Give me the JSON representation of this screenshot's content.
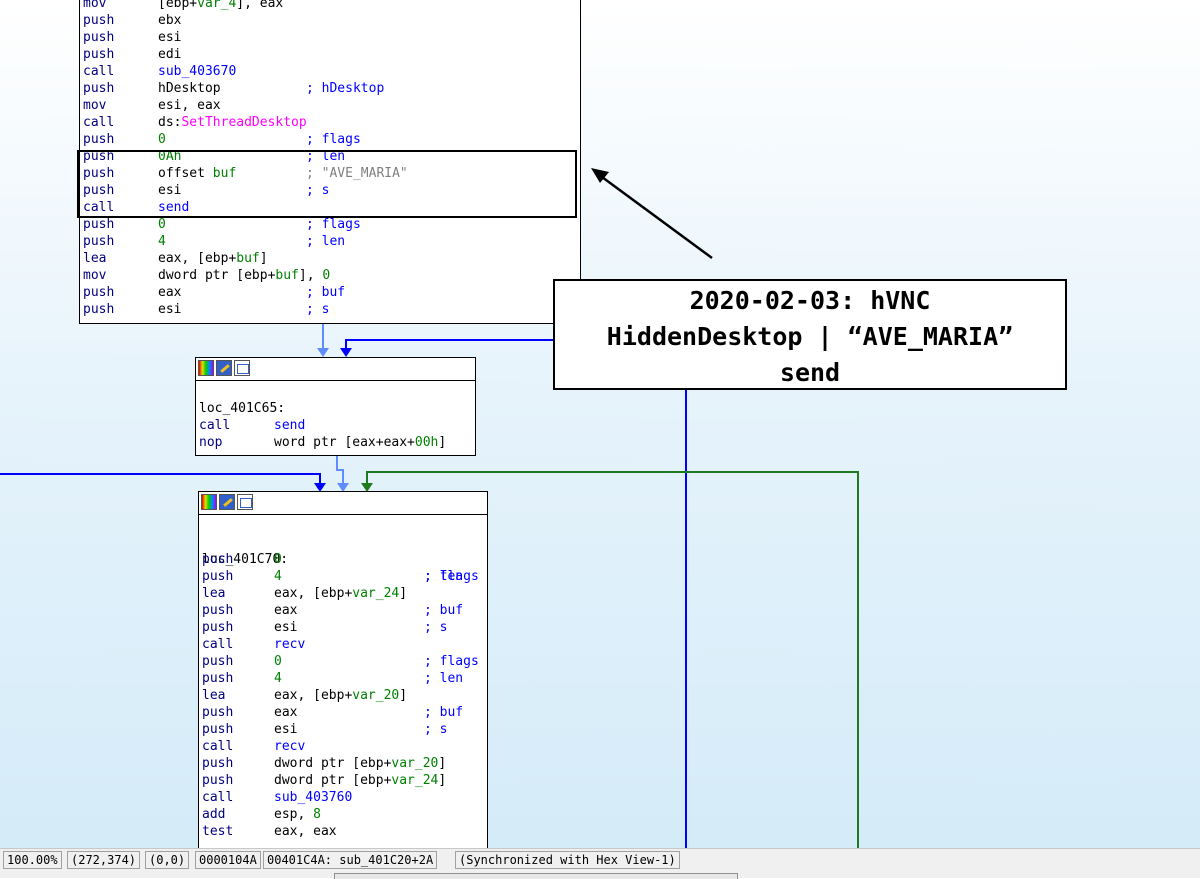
{
  "block1": {
    "lines": [
      {
        "mn": "mov",
        "op": "[ebp+var_4], eax"
      },
      {
        "mn": "push",
        "op": "ebx"
      },
      {
        "mn": "push",
        "op": "esi"
      },
      {
        "mn": "push",
        "op": "edi"
      },
      {
        "mn": "call",
        "op": "sub_403670"
      },
      {
        "mn": "push",
        "op": "hDesktop",
        "cm": "; hDesktop"
      },
      {
        "mn": "mov",
        "op": "esi, eax"
      },
      {
        "mn": "call",
        "op_prefix": "ds:",
        "op_api": "SetThreadDesktop"
      },
      {
        "mn": "push",
        "op": "0",
        "cm": "; flags"
      },
      {
        "mn": "push",
        "op": "0Ah",
        "cm": "; len"
      },
      {
        "mn": "push",
        "op": "offset buf",
        "cm": "; \"AVE_MARIA\""
      },
      {
        "mn": "push",
        "op": "esi",
        "cm": "; s"
      },
      {
        "mn": "call",
        "op": "send"
      },
      {
        "mn": "push",
        "op": "0",
        "cm": "; flags"
      },
      {
        "mn": "push",
        "op": "4",
        "cm": "; len"
      },
      {
        "mn": "lea",
        "op": "eax, [ebp+buf]"
      },
      {
        "mn": "mov",
        "op": "dword ptr [ebp+buf], 0"
      },
      {
        "mn": "push",
        "op": "eax",
        "cm": "; buf"
      },
      {
        "mn": "push",
        "op": "esi",
        "cm": "; s"
      }
    ]
  },
  "block2": {
    "label": "loc_401C65:",
    "lines": [
      {
        "mn": "call",
        "op": "send"
      },
      {
        "mn": "nop",
        "op": "word ptr [eax+eax+00h]"
      }
    ]
  },
  "block3": {
    "label": "loc_401C70:",
    "label_comment": "; flags",
    "lines": [
      {
        "mn": "push",
        "op": "0"
      },
      {
        "mn": "push",
        "op": "4",
        "cm": "; len"
      },
      {
        "mn": "lea",
        "op": "eax, [ebp+var_24]"
      },
      {
        "mn": "push",
        "op": "eax",
        "cm": "; buf"
      },
      {
        "mn": "push",
        "op": "esi",
        "cm": "; s"
      },
      {
        "mn": "call",
        "op": "recv"
      },
      {
        "mn": "push",
        "op": "0",
        "cm": "; flags"
      },
      {
        "mn": "push",
        "op": "4",
        "cm": "; len"
      },
      {
        "mn": "lea",
        "op": "eax, [ebp+var_20]"
      },
      {
        "mn": "push",
        "op": "eax",
        "cm": "; buf"
      },
      {
        "mn": "push",
        "op": "esi",
        "cm": "; s"
      },
      {
        "mn": "call",
        "op": "recv"
      },
      {
        "mn": "push",
        "op": "dword ptr [ebp+var_20]"
      },
      {
        "mn": "push",
        "op": "dword ptr [ebp+var_24]"
      },
      {
        "mn": "call",
        "op": "sub_403760"
      },
      {
        "mn": "add",
        "op": "esp, 8"
      },
      {
        "mn": "test",
        "op": "eax, eax"
      }
    ]
  },
  "annotation": {
    "line1": "2020-02-03: hVNC",
    "line2": "HiddenDesktop | “AVE_MARIA”",
    "line3": "send"
  },
  "statusbar": {
    "zoom": "100.00%",
    "coords": "(272,374)",
    "origin": "(0,0)",
    "offset": "0000104A",
    "address": "00401C4A: sub_401C20+2A",
    "sync": "(Synchronized with Hex View-1)"
  },
  "colors": {
    "edge_blue": "#0000ff",
    "edge_green": "#1f7a1f",
    "edge_lightblue": "#5f8cff",
    "mnemonic": "#000080",
    "number": "#008000",
    "comment": "#0000ff",
    "api": "#ff00ff"
  }
}
